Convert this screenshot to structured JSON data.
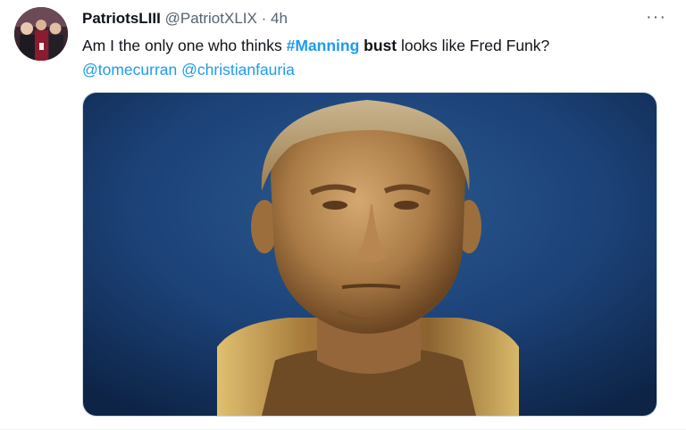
{
  "tweet": {
    "display_name": "PatriotsLIII",
    "handle": "@PatriotXLIX",
    "separator": "·",
    "time": "4h",
    "more_glyph": "···",
    "text_before": "Am I the only one who thinks ",
    "hashtag": "#Manning",
    "bold_word": "bust",
    "text_after": " looks like Fred Funk?",
    "mention_1": "@tomecurran",
    "mention_2": "@christianfauria",
    "media_alt": "Bronze bust of a football player"
  },
  "colors": {
    "link": "#1d9bf0",
    "secondary_text": "#536471",
    "primary_text": "#0f1419",
    "media_background": "#1a3a66",
    "bronze": "#b8894f"
  },
  "icons": [
    "avatar-photo",
    "more-options-icon"
  ]
}
